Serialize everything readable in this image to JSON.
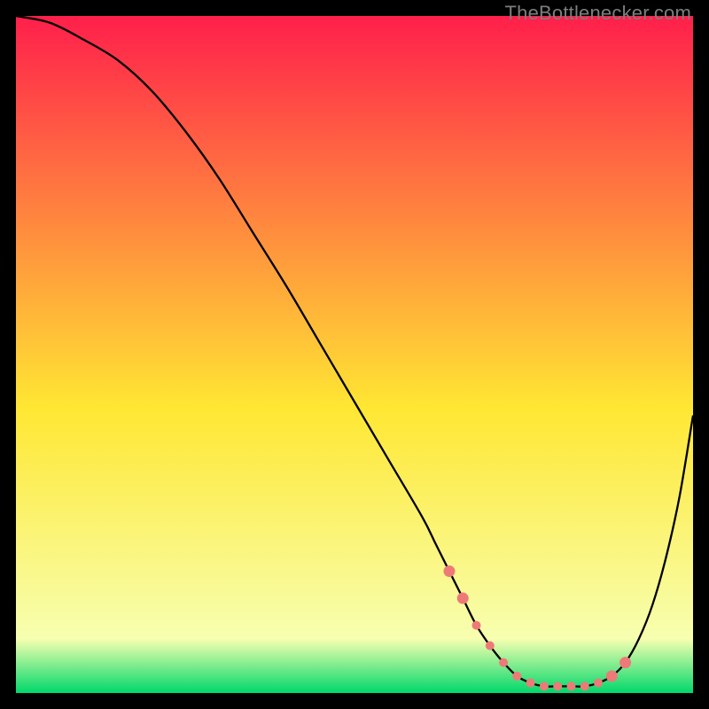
{
  "attribution": "TheBottlenecker.com",
  "chart_data": {
    "type": "line",
    "title": "",
    "xlabel": "",
    "ylabel": "",
    "xlim": [
      0,
      100
    ],
    "ylim": [
      0,
      100
    ],
    "gradient": {
      "top_color": "#ff1f4b",
      "mid_color": "#ffe733",
      "bottom_color": "#00d86b"
    },
    "series": [
      {
        "name": "bottleneck-curve",
        "x": [
          0,
          5,
          10,
          15,
          20,
          25,
          30,
          35,
          40,
          45,
          50,
          55,
          60,
          62,
          64,
          66,
          68,
          70,
          72,
          74,
          76,
          78,
          80,
          82,
          84,
          86,
          88,
          90,
          92,
          94,
          96,
          98,
          100
        ],
        "y": [
          100,
          99,
          96.5,
          93.5,
          89,
          83,
          76,
          68,
          60,
          51.5,
          43,
          34.5,
          26,
          22,
          18,
          14,
          10,
          7,
          4.5,
          2.5,
          1.5,
          1,
          1,
          1,
          1,
          1.5,
          2.5,
          4.5,
          8,
          13,
          20,
          29,
          41
        ]
      }
    ],
    "markers": {
      "name": "highlight-dots",
      "color": "#ee7a78",
      "x": [
        64,
        66,
        68,
        70,
        72,
        74,
        76,
        78,
        80,
        82,
        84,
        86,
        88,
        90
      ],
      "y": [
        18,
        14,
        10,
        7,
        4.5,
        2.5,
        1.5,
        1,
        1,
        1,
        1,
        1.5,
        2.5,
        4.5
      ]
    }
  }
}
